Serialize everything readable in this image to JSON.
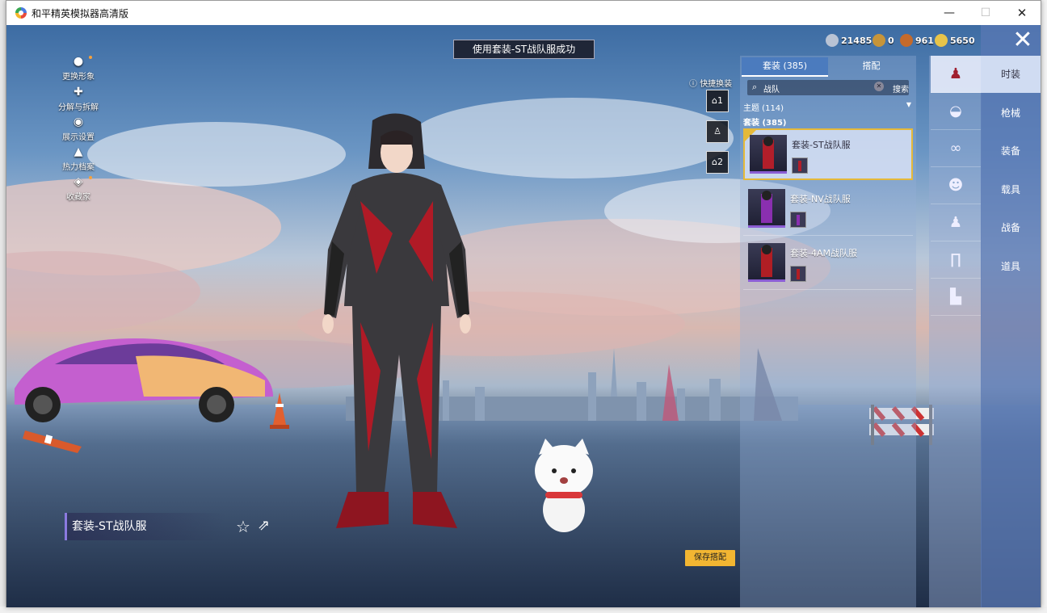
{
  "window": {
    "title": "和平精英模拟器高清版",
    "minimize": "—",
    "maximize": "☐",
    "close": "✕"
  },
  "currency": [
    {
      "name": "silver",
      "value": "21485",
      "color": "#b9c3d4"
    },
    {
      "name": "gold",
      "value": "0",
      "color": "#c7953a"
    },
    {
      "name": "coupon",
      "value": "961",
      "color": "#c56a2b"
    },
    {
      "name": "bp",
      "value": "5650",
      "color": "#e8c44a"
    }
  ],
  "toast": "使用套装-ST战队服成功",
  "left_menu": [
    {
      "label": "更换形象",
      "icon": "person-icon"
    },
    {
      "label": "分解与拆解",
      "icon": "puzzle-icon"
    },
    {
      "label": "展示设置",
      "icon": "eye-icon"
    },
    {
      "label": "热力档案",
      "icon": "flame-icon"
    },
    {
      "label": "收藏家",
      "icon": "badge-icon"
    }
  ],
  "quick_change": {
    "label": "快捷换装",
    "slots": [
      "1",
      "",
      "2"
    ]
  },
  "panel": {
    "tabs": [
      "套装 (385)",
      "搭配"
    ],
    "search_value": "战队",
    "search_button": "搜索",
    "theme_label": "主题 (114)",
    "count_label": "套装 (385)",
    "items": [
      {
        "name": "套装-ST战队服",
        "selected": true,
        "accent": "#b21e2a"
      },
      {
        "name": "套装-NV战队服",
        "selected": false,
        "accent": "#8a2fb0"
      },
      {
        "name": "套装-4AM战队服",
        "selected": false,
        "accent": "#b01e24"
      }
    ]
  },
  "categories": [
    "outfit-icon",
    "hat-icon",
    "glasses-icon",
    "mask-icon",
    "top-icon",
    "pants-icon",
    "shoes-icon"
  ],
  "right_tabs": [
    "时装",
    "枪械",
    "装备",
    "载具",
    "战备",
    "道具"
  ],
  "current_outfit": "套装-ST战队服",
  "save_button": "保存搭配"
}
